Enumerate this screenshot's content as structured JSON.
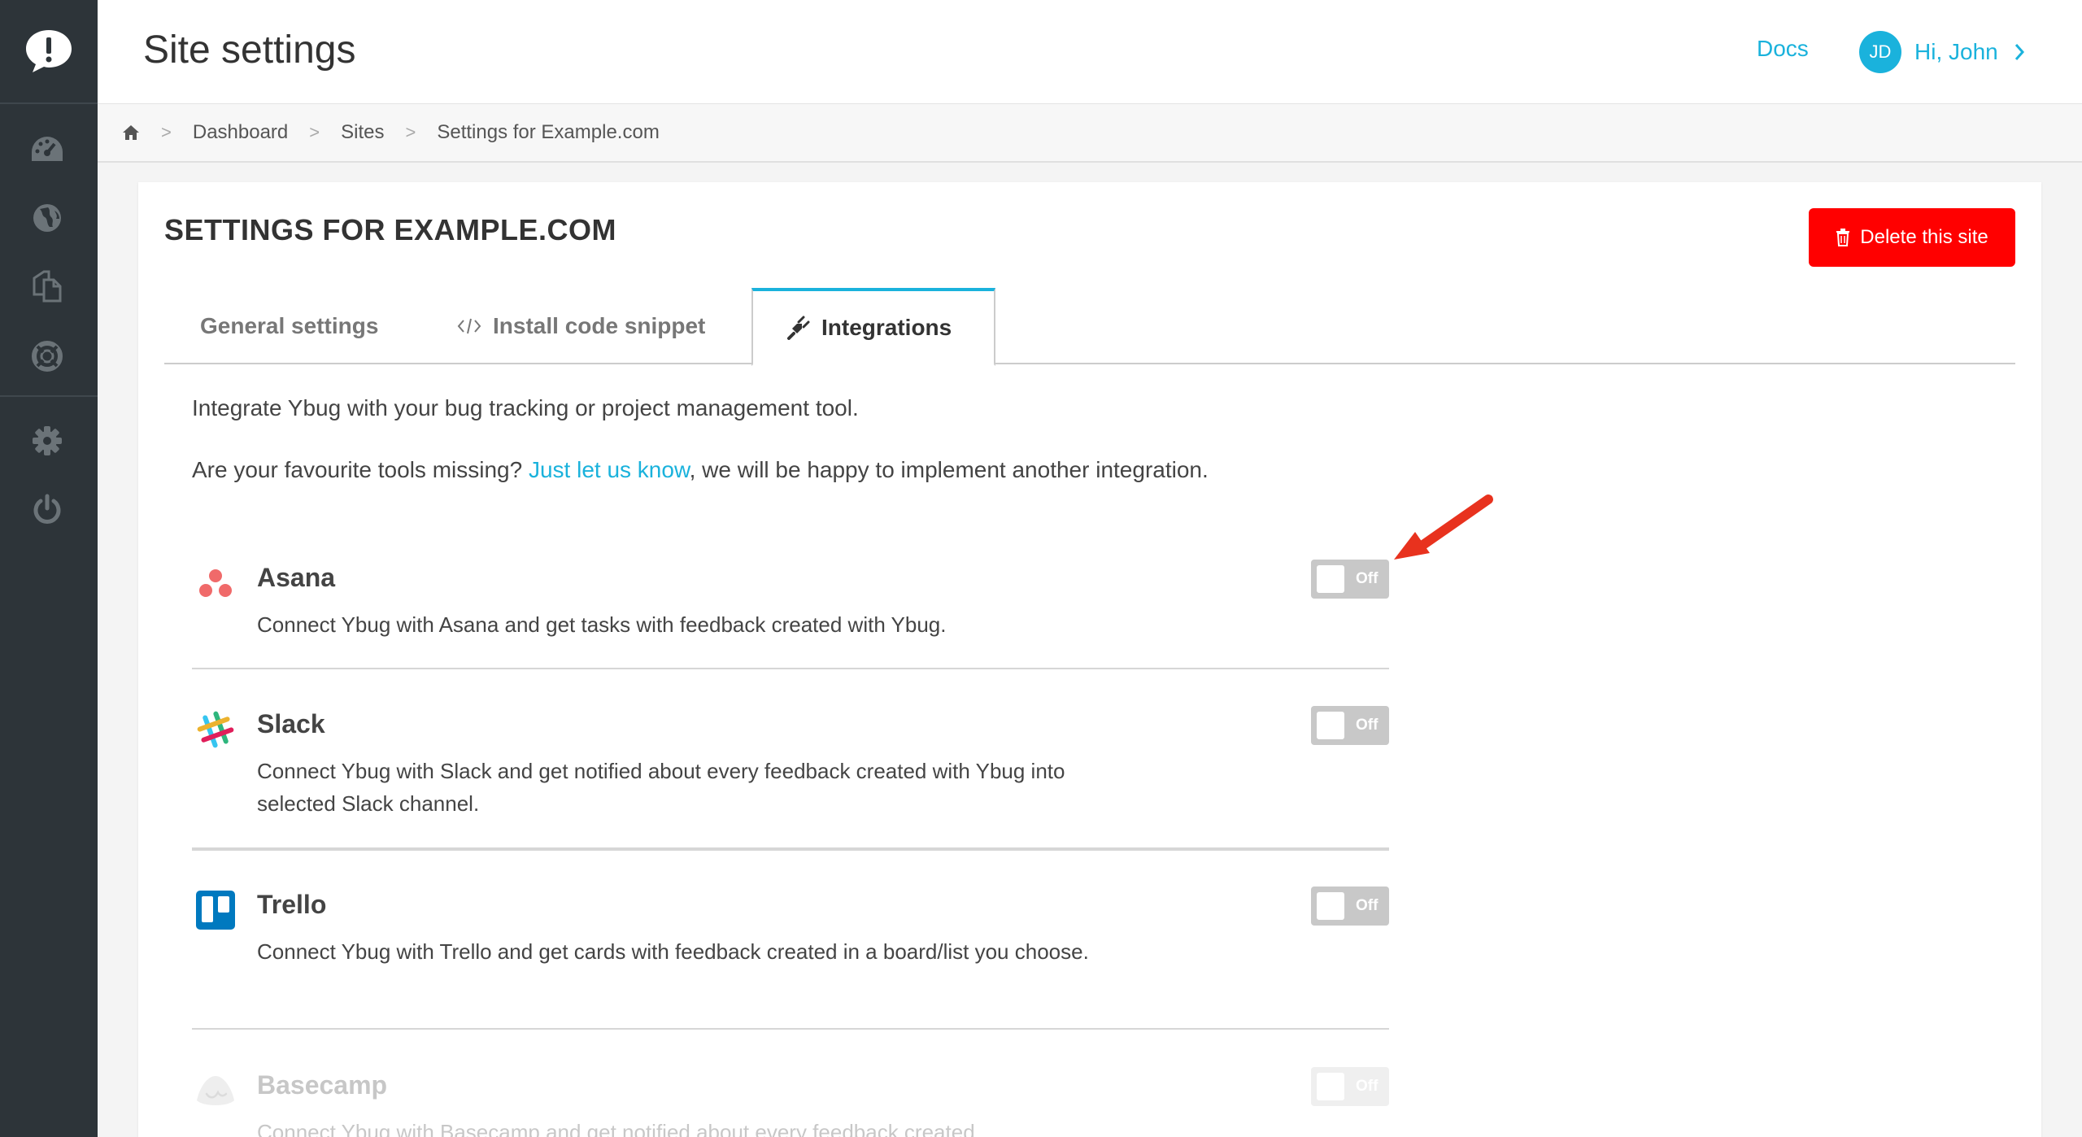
{
  "header": {
    "title": "Site settings",
    "docs_label": "Docs",
    "avatar_initials": "JD",
    "greeting": "Hi, John"
  },
  "sidebar": {
    "items": [
      {
        "icon": "dashboard-icon"
      },
      {
        "icon": "globe-icon"
      },
      {
        "icon": "copy-icon"
      },
      {
        "icon": "lifebuoy-icon"
      },
      {
        "icon": "gear-icon"
      },
      {
        "icon": "power-icon"
      }
    ]
  },
  "breadcrumb": {
    "items": [
      "Dashboard",
      "Sites",
      "Settings for Example.com"
    ]
  },
  "card": {
    "title": "SETTINGS FOR EXAMPLE.COM",
    "delete_label": "Delete this site"
  },
  "tabs": [
    {
      "label": "General settings"
    },
    {
      "label": "Install code snippet"
    },
    {
      "label": "Integrations"
    }
  ],
  "intro": {
    "line1": "Integrate Ybug with your bug tracking or project management tool.",
    "line2_before": "Are your favourite tools missing? ",
    "line2_link": "Just let us know",
    "line2_after": ", we will be happy to implement another integration."
  },
  "integrations": [
    {
      "name": "Asana",
      "description": "Connect Ybug with Asana and get tasks with feedback created with Ybug.",
      "toggle": "Off"
    },
    {
      "name": "Slack",
      "description": "Connect Ybug with Slack and get notified about every feedback created with Ybug into selected Slack channel.",
      "toggle": "Off"
    },
    {
      "name": "Trello",
      "description": "Connect Ybug with Trello and get cards with feedback created in a board/list you choose.",
      "toggle": "Off"
    },
    {
      "name": "Basecamp",
      "description": "Connect Ybug with Basecamp and get notified about every feedback created",
      "toggle": "Off"
    }
  ],
  "colors": {
    "accent": "#1ab2dc",
    "danger": "#ff0000",
    "sidebar": "#2d3439",
    "arrow": "#e8321e"
  }
}
